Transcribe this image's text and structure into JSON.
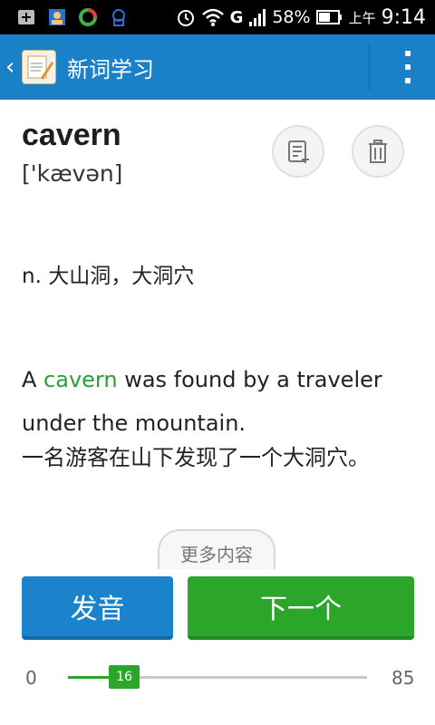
{
  "status_bar": {
    "battery": "58%",
    "ampm": "上午",
    "time": "9:14",
    "network": "G",
    "icons": [
      "add-icon",
      "contact-card-icon",
      "sync-icon",
      "mascot-icon",
      "alarm-icon",
      "wifi-icon",
      "signal-icon",
      "battery-icon"
    ]
  },
  "action_bar": {
    "title": "新词学习",
    "accent": "#1a80c8"
  },
  "word": {
    "text": "cavern",
    "phonetic": "['kævən]"
  },
  "definition": "n. 大山洞，大洞穴",
  "example": {
    "prefix": "A ",
    "highlight": "cavern",
    "suffix": " was found by a traveler under the mountain.",
    "translation": "一名游客在山下发现了一个大洞穴。",
    "highlight_color": "#2aa035"
  },
  "more_label": "更多内容",
  "buttons": {
    "pronounce": "发音",
    "next": "下一个"
  },
  "progress": {
    "min": "0",
    "max": "85",
    "current": "16",
    "value": 16,
    "total": 85
  }
}
